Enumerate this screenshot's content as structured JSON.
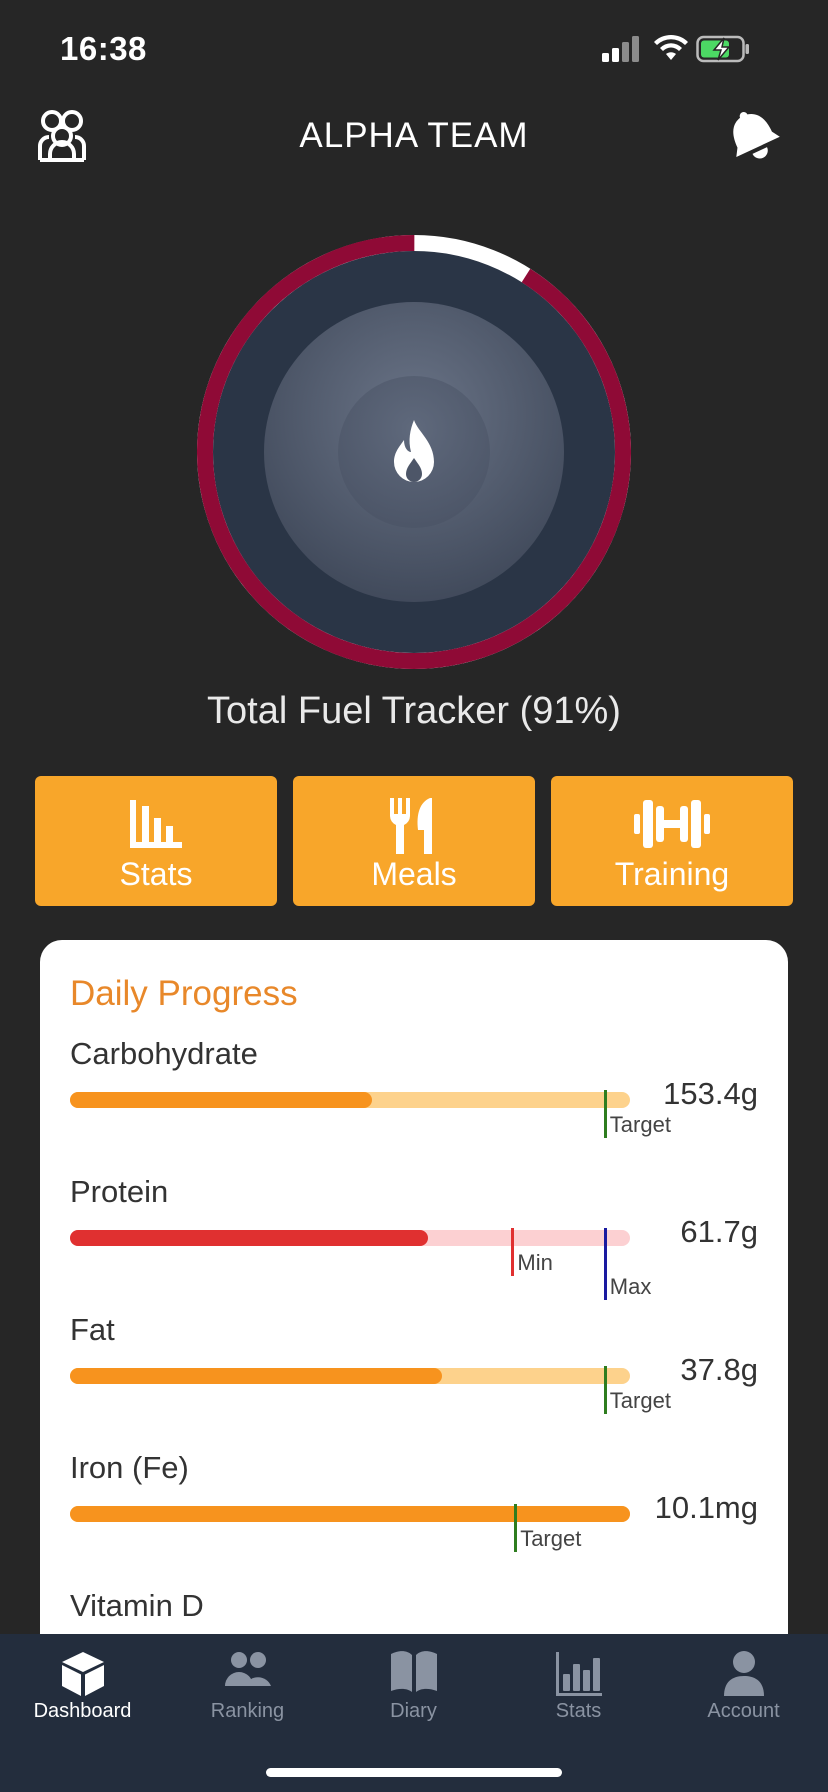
{
  "status_bar": {
    "time": "16:38",
    "icons": [
      "cellular-signal-icon",
      "wifi-icon",
      "battery-charging-icon"
    ]
  },
  "header": {
    "title": "ALPHA TEAM",
    "left_icon": "team-icon",
    "right_icon": "notification-bell-icon"
  },
  "tracker": {
    "label": "Total Fuel Tracker (91%)",
    "progress": 0.91,
    "center_icon": "flame-icon",
    "colors": {
      "progress": "#8f0a36",
      "remaining": "#ffffff",
      "inner": "#2a3546"
    }
  },
  "actions": [
    {
      "label": "Stats",
      "icon": "bar-chart-icon"
    },
    {
      "label": "Meals",
      "icon": "fork-knife-icon"
    },
    {
      "label": "Training",
      "icon": "dumbbell-icon"
    }
  ],
  "daily_progress": {
    "title": "Daily Progress",
    "items": [
      {
        "name": "Carbohydrate",
        "value": "153.4g",
        "fill": 0.54,
        "color": "#f7931e",
        "track_color": "#fdd28c",
        "markers": [
          {
            "label": "Target",
            "position": 0.955,
            "color": "#2e7d1f"
          }
        ]
      },
      {
        "name": "Protein",
        "value": "61.7g",
        "fill": 0.64,
        "color": "#e03030",
        "track_color": "#fcd0d2",
        "markers": [
          {
            "label": "Min",
            "position": 0.79,
            "color": "#e03030"
          },
          {
            "label": "Max",
            "position": 0.955,
            "color": "#1a1aa0"
          }
        ]
      },
      {
        "name": "Fat",
        "value": "37.8g",
        "fill": 0.665,
        "color": "#f7931e",
        "track_color": "#fdd28c",
        "markers": [
          {
            "label": "Target",
            "position": 0.955,
            "color": "#2e7d1f"
          }
        ]
      },
      {
        "name": "Iron (Fe)",
        "value": "10.1mg",
        "fill": 1.0,
        "color": "#f7931e",
        "track_color": "#fdd28c",
        "markers": [
          {
            "label": "Target",
            "position": 0.795,
            "color": "#2e7d1f"
          }
        ]
      },
      {
        "name": "Vitamin D"
      }
    ]
  },
  "tabs": [
    {
      "label": "Dashboard",
      "icon": "cube-icon",
      "active": true
    },
    {
      "label": "Ranking",
      "icon": "people-icon",
      "active": false
    },
    {
      "label": "Diary",
      "icon": "book-icon",
      "active": false
    },
    {
      "label": "Stats",
      "icon": "stats-chart-icon",
      "active": false
    },
    {
      "label": "Account",
      "icon": "person-icon",
      "active": false
    }
  ]
}
